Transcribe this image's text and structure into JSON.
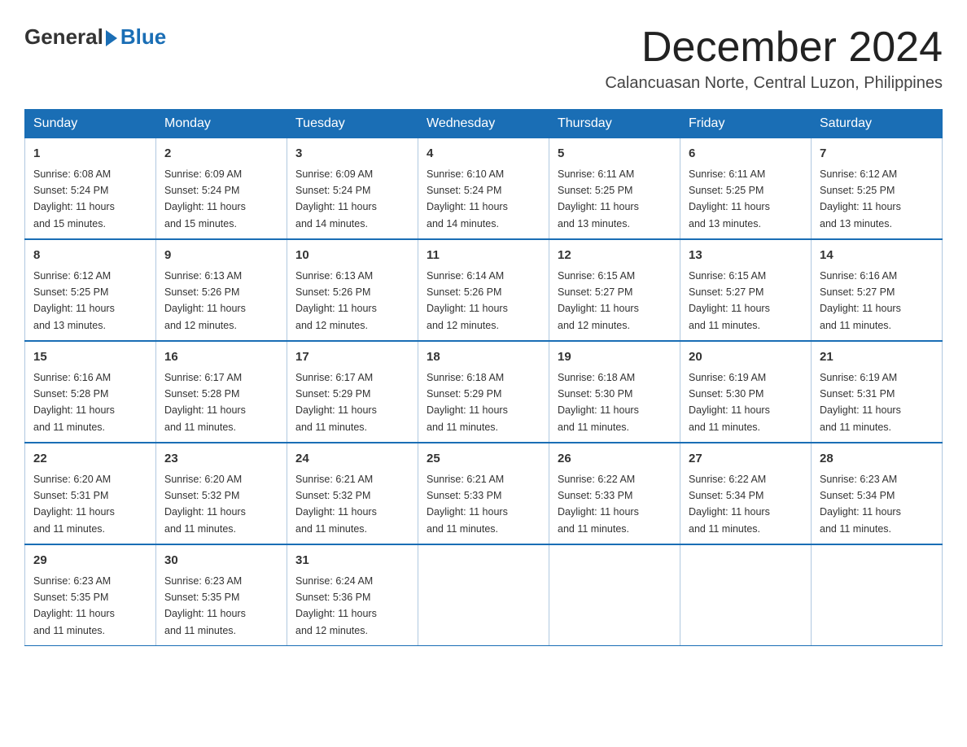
{
  "logo": {
    "general": "General",
    "blue": "Blue"
  },
  "header": {
    "month": "December 2024",
    "location": "Calancuasan Norte, Central Luzon, Philippines"
  },
  "weekdays": [
    "Sunday",
    "Monday",
    "Tuesday",
    "Wednesday",
    "Thursday",
    "Friday",
    "Saturday"
  ],
  "weeks": [
    [
      {
        "day": 1,
        "sunrise": "6:08 AM",
        "sunset": "5:24 PM",
        "daylight": "11 hours and 15 minutes."
      },
      {
        "day": 2,
        "sunrise": "6:09 AM",
        "sunset": "5:24 PM",
        "daylight": "11 hours and 15 minutes."
      },
      {
        "day": 3,
        "sunrise": "6:09 AM",
        "sunset": "5:24 PM",
        "daylight": "11 hours and 14 minutes."
      },
      {
        "day": 4,
        "sunrise": "6:10 AM",
        "sunset": "5:24 PM",
        "daylight": "11 hours and 14 minutes."
      },
      {
        "day": 5,
        "sunrise": "6:11 AM",
        "sunset": "5:25 PM",
        "daylight": "11 hours and 13 minutes."
      },
      {
        "day": 6,
        "sunrise": "6:11 AM",
        "sunset": "5:25 PM",
        "daylight": "11 hours and 13 minutes."
      },
      {
        "day": 7,
        "sunrise": "6:12 AM",
        "sunset": "5:25 PM",
        "daylight": "11 hours and 13 minutes."
      }
    ],
    [
      {
        "day": 8,
        "sunrise": "6:12 AM",
        "sunset": "5:25 PM",
        "daylight": "11 hours and 13 minutes."
      },
      {
        "day": 9,
        "sunrise": "6:13 AM",
        "sunset": "5:26 PM",
        "daylight": "11 hours and 12 minutes."
      },
      {
        "day": 10,
        "sunrise": "6:13 AM",
        "sunset": "5:26 PM",
        "daylight": "11 hours and 12 minutes."
      },
      {
        "day": 11,
        "sunrise": "6:14 AM",
        "sunset": "5:26 PM",
        "daylight": "11 hours and 12 minutes."
      },
      {
        "day": 12,
        "sunrise": "6:15 AM",
        "sunset": "5:27 PM",
        "daylight": "11 hours and 12 minutes."
      },
      {
        "day": 13,
        "sunrise": "6:15 AM",
        "sunset": "5:27 PM",
        "daylight": "11 hours and 11 minutes."
      },
      {
        "day": 14,
        "sunrise": "6:16 AM",
        "sunset": "5:27 PM",
        "daylight": "11 hours and 11 minutes."
      }
    ],
    [
      {
        "day": 15,
        "sunrise": "6:16 AM",
        "sunset": "5:28 PM",
        "daylight": "11 hours and 11 minutes."
      },
      {
        "day": 16,
        "sunrise": "6:17 AM",
        "sunset": "5:28 PM",
        "daylight": "11 hours and 11 minutes."
      },
      {
        "day": 17,
        "sunrise": "6:17 AM",
        "sunset": "5:29 PM",
        "daylight": "11 hours and 11 minutes."
      },
      {
        "day": 18,
        "sunrise": "6:18 AM",
        "sunset": "5:29 PM",
        "daylight": "11 hours and 11 minutes."
      },
      {
        "day": 19,
        "sunrise": "6:18 AM",
        "sunset": "5:30 PM",
        "daylight": "11 hours and 11 minutes."
      },
      {
        "day": 20,
        "sunrise": "6:19 AM",
        "sunset": "5:30 PM",
        "daylight": "11 hours and 11 minutes."
      },
      {
        "day": 21,
        "sunrise": "6:19 AM",
        "sunset": "5:31 PM",
        "daylight": "11 hours and 11 minutes."
      }
    ],
    [
      {
        "day": 22,
        "sunrise": "6:20 AM",
        "sunset": "5:31 PM",
        "daylight": "11 hours and 11 minutes."
      },
      {
        "day": 23,
        "sunrise": "6:20 AM",
        "sunset": "5:32 PM",
        "daylight": "11 hours and 11 minutes."
      },
      {
        "day": 24,
        "sunrise": "6:21 AM",
        "sunset": "5:32 PM",
        "daylight": "11 hours and 11 minutes."
      },
      {
        "day": 25,
        "sunrise": "6:21 AM",
        "sunset": "5:33 PM",
        "daylight": "11 hours and 11 minutes."
      },
      {
        "day": 26,
        "sunrise": "6:22 AM",
        "sunset": "5:33 PM",
        "daylight": "11 hours and 11 minutes."
      },
      {
        "day": 27,
        "sunrise": "6:22 AM",
        "sunset": "5:34 PM",
        "daylight": "11 hours and 11 minutes."
      },
      {
        "day": 28,
        "sunrise": "6:23 AM",
        "sunset": "5:34 PM",
        "daylight": "11 hours and 11 minutes."
      }
    ],
    [
      {
        "day": 29,
        "sunrise": "6:23 AM",
        "sunset": "5:35 PM",
        "daylight": "11 hours and 11 minutes."
      },
      {
        "day": 30,
        "sunrise": "6:23 AM",
        "sunset": "5:35 PM",
        "daylight": "11 hours and 11 minutes."
      },
      {
        "day": 31,
        "sunrise": "6:24 AM",
        "sunset": "5:36 PM",
        "daylight": "11 hours and 12 minutes."
      },
      null,
      null,
      null,
      null
    ]
  ],
  "labels": {
    "sunrise": "Sunrise:",
    "sunset": "Sunset:",
    "daylight": "Daylight:"
  }
}
